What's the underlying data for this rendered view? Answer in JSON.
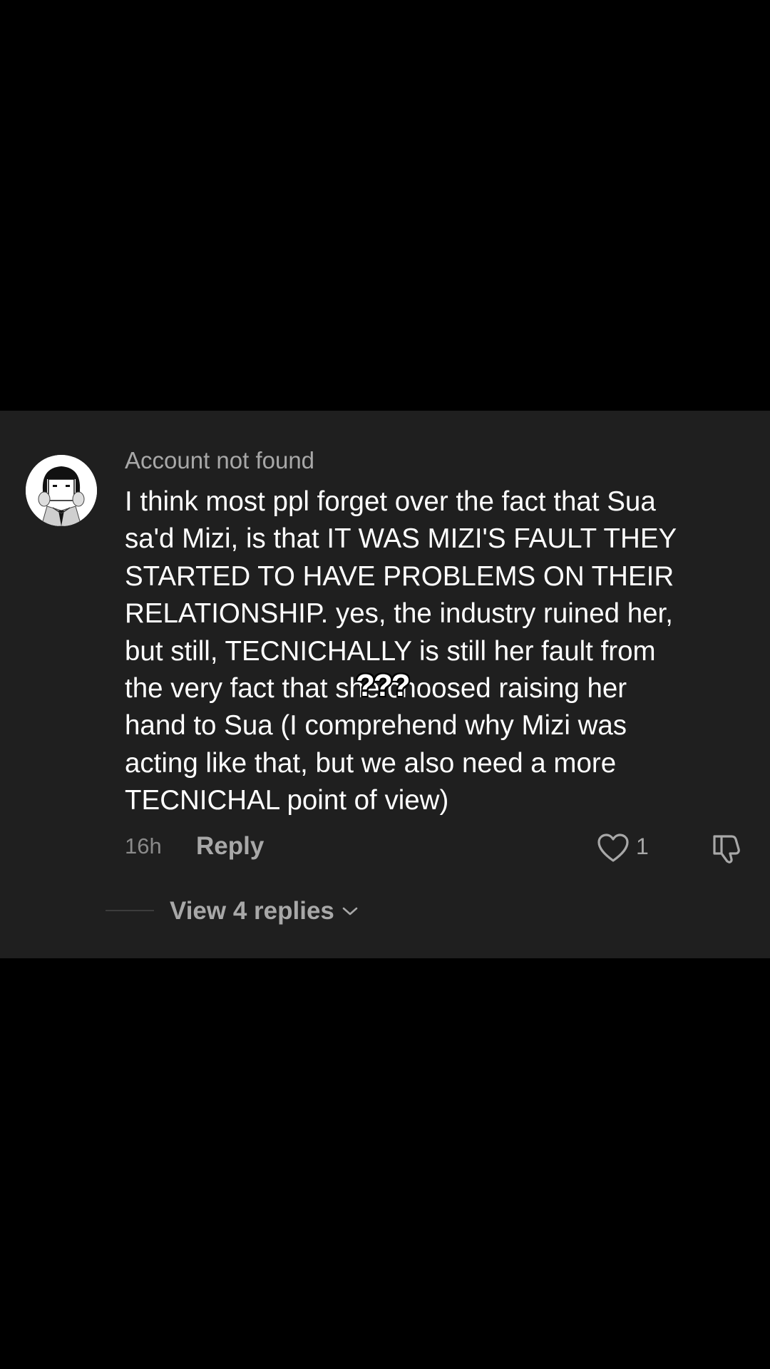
{
  "comment": {
    "username": "Account not found",
    "text": "I think most ppl forget over the fact that Sua\nsa'd Mizi, is that IT WAS MIZI'S FAULT THEY\nSTARTED TO HAVE PROBLEMS ON THEIR\nRELATIONSHIP. yes, the industry ruined her,\nbut still, TECNICHALLY is still her fault from\nthe very fact that she choosed raising her\nhand to Sua (I comprehend why Mizi was\nacting like that, but we also need a more\nTECNICHAL point of view)",
    "sticker": "???",
    "time": "16h",
    "reply_label": "Reply",
    "like_count": "1",
    "view_replies_label": "View 4 replies"
  },
  "icons": {
    "avatar": "manga-avatar",
    "like": "heart-icon",
    "dislike": "thumbs-down-icon",
    "expand": "chevron-down-icon"
  },
  "colors": {
    "background": "#000000",
    "card": "#1f1f1f",
    "text_primary": "#ffffff",
    "text_secondary": "#a8a8a8"
  }
}
